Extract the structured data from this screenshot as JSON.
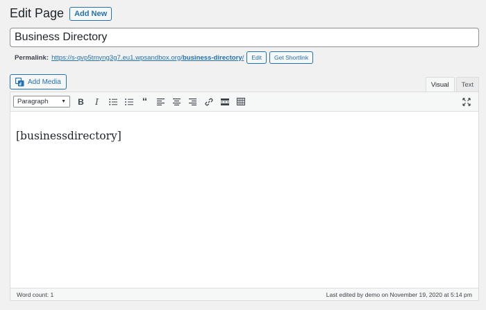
{
  "header": {
    "title": "Edit Page",
    "add_new_label": "Add New"
  },
  "post": {
    "title": "Business Directory",
    "content": "[businessdirectory]"
  },
  "permalink": {
    "label": "Permalink:",
    "url_base": "https://s-qvp5tmyng3g7.eu1.wpsandbox.org/",
    "slug": "business-directory",
    "url_suffix": "/",
    "edit_label": "Edit",
    "shortlink_label": "Get Shortlink"
  },
  "media": {
    "add_media_label": "Add Media"
  },
  "tabs": [
    {
      "label": "Visual",
      "active": true
    },
    {
      "label": "Text",
      "active": false
    }
  ],
  "toolbar": {
    "format_value": "Paragraph",
    "buttons": [
      "bold-icon",
      "italic-icon",
      "bulleted-list-icon",
      "numbered-list-icon",
      "blockquote-icon",
      "align-left-icon",
      "align-center-icon",
      "align-right-icon",
      "link-icon",
      "read-more-icon",
      "toolbar-toggle-icon"
    ]
  },
  "status": {
    "word_count": "Word count: 1",
    "last_edited": "Last edited by demo on November 19, 2020 at 5:14 pm"
  },
  "colors": {
    "accent": "#2271b1",
    "background": "#f1f1f1",
    "border": "#dcdcde"
  }
}
